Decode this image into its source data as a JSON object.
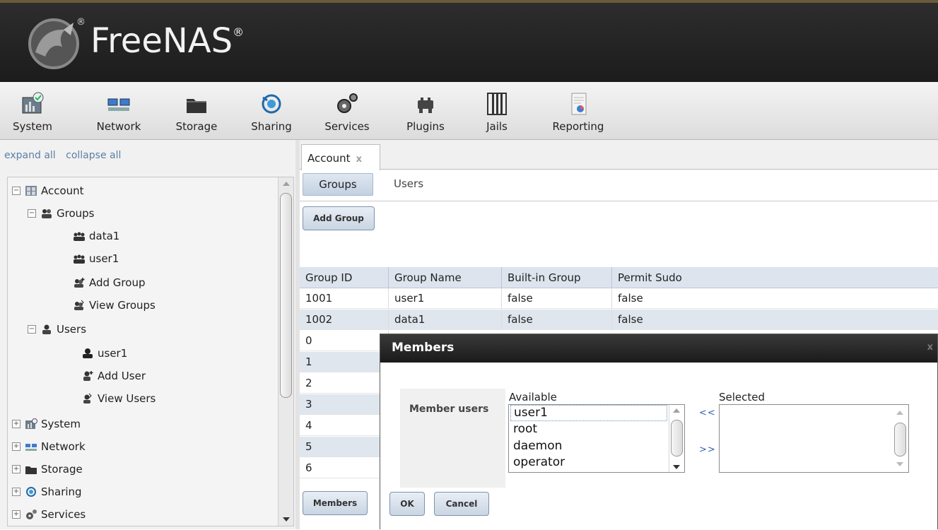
{
  "app": {
    "brand": "FreeNAS",
    "brand_mark": "®"
  },
  "toolbar": {
    "items": [
      {
        "label": "System",
        "icon": "system-icon"
      },
      {
        "label": "Network",
        "icon": "network-icon"
      },
      {
        "label": "Storage",
        "icon": "storage-icon"
      },
      {
        "label": "Sharing",
        "icon": "sharing-icon"
      },
      {
        "label": "Services",
        "icon": "services-icon"
      },
      {
        "label": "Plugins",
        "icon": "plugins-icon"
      },
      {
        "label": "Jails",
        "icon": "jails-icon"
      },
      {
        "label": "Reporting",
        "icon": "reporting-icon"
      }
    ]
  },
  "sidebar": {
    "expand_all": "expand all",
    "collapse_all": "collapse all",
    "tree": [
      {
        "label": "Account",
        "toggle": "−",
        "icon": "account-icon"
      },
      {
        "label": "Groups",
        "toggle": "−",
        "icon": "groups-icon"
      },
      {
        "label": "data1",
        "icon": "group-icon"
      },
      {
        "label": "user1",
        "icon": "group-icon"
      },
      {
        "label": "Add Group",
        "icon": "add-group-icon"
      },
      {
        "label": "View Groups",
        "icon": "view-groups-icon"
      },
      {
        "label": "Users",
        "toggle": "−",
        "icon": "users-icon"
      },
      {
        "label": "user1",
        "icon": "user-icon"
      },
      {
        "label": "Add User",
        "icon": "add-user-icon"
      },
      {
        "label": "View Users",
        "icon": "view-users-icon"
      },
      {
        "label": "System",
        "toggle": "+",
        "icon": "system-icon"
      },
      {
        "label": "Network",
        "toggle": "+",
        "icon": "network-icon"
      },
      {
        "label": "Storage",
        "toggle": "+",
        "icon": "storage-icon"
      },
      {
        "label": "Sharing",
        "toggle": "+",
        "icon": "sharing-icon"
      },
      {
        "label": "Services",
        "toggle": "+",
        "icon": "services-icon"
      }
    ]
  },
  "main": {
    "tab": {
      "label": "Account",
      "close": "x"
    },
    "subtabs": {
      "groups": "Groups",
      "users": "Users"
    },
    "add_group_button": "Add Group",
    "table": {
      "columns": [
        "Group ID",
        "Group Name",
        "Built-in Group",
        "Permit Sudo"
      ],
      "rows": [
        [
          "1001",
          "user1",
          "false",
          "false"
        ],
        [
          "1002",
          "data1",
          "false",
          "false"
        ],
        [
          "0",
          "",
          "",
          ""
        ],
        [
          "1",
          "",
          "",
          ""
        ],
        [
          "2",
          "",
          "",
          ""
        ],
        [
          "3",
          "",
          "",
          ""
        ],
        [
          "4",
          "",
          "",
          ""
        ],
        [
          "5",
          "",
          "",
          ""
        ],
        [
          "6",
          "",
          "",
          ""
        ]
      ]
    },
    "members_button": "Members"
  },
  "dialog": {
    "title": "Members",
    "close": "x",
    "field_label": "Member users",
    "available_title": "Available",
    "selected_title": "Selected",
    "available_options": [
      "user1",
      "root",
      "daemon",
      "operator"
    ],
    "selected_options": [],
    "move_left": "<<",
    "move_right": ">>",
    "ok": "OK",
    "cancel": "Cancel"
  }
}
